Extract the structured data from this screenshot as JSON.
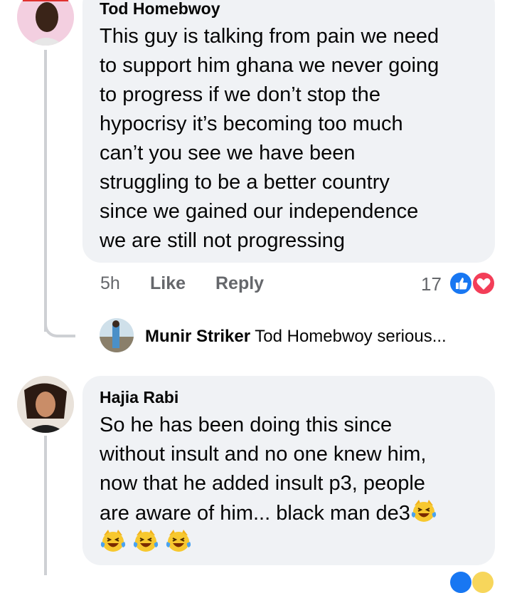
{
  "comments": [
    {
      "author": "Tod Homebwoy",
      "lines": [
        "This guy is talking from pain we need",
        "to support him ghana we never going",
        "to progress if we don’t stop the",
        "hypocrisy it’s becoming too much",
        "can’t you see we have been",
        "struggling to be a better country",
        "since we gained our independence",
        "we are still not progressing"
      ],
      "time": "5h",
      "like_label": "Like",
      "reply_label": "Reply",
      "reaction_count": "17",
      "reactions": [
        "like-icon",
        "love-icon"
      ],
      "reply_preview": {
        "author": "Munir Striker",
        "text": "Tod Homebwoy  serious..."
      }
    },
    {
      "author": "Hajia Rabi",
      "lines": [
        "So he has been doing this since",
        "without insult and no one knew him,",
        "now that he added insult p3, people",
        "are aware of him... black man de3"
      ],
      "emoji_count": 4
    }
  ],
  "colors": {
    "bubble": "#f0f2f5",
    "thread_line": "#ced0d4",
    "secondary_text": "#65676b",
    "like_blue": "#1877f2",
    "love_red": "#f33e58"
  }
}
